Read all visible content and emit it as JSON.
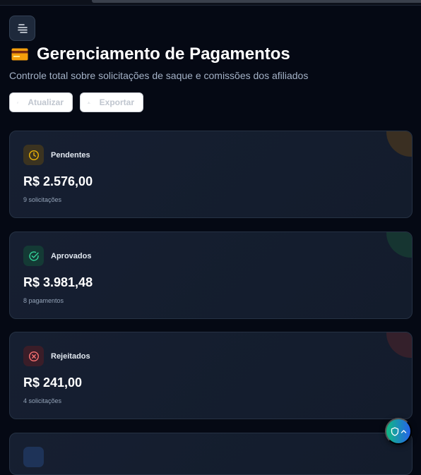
{
  "header": {
    "menu_icon": "menu-list-icon",
    "title_icon": "credit-card-icon",
    "title": "Gerenciamento de Pagamentos",
    "subtitle": "Controle total sobre solicitações de saque e comissões dos afiliados"
  },
  "toolbar": {
    "refresh_label": "Atualizar",
    "refresh_icon": "refresh-icon",
    "export_label": "Exportar",
    "export_icon": "download-icon"
  },
  "stats": [
    {
      "label": "Pendentes",
      "amount": "R$ 2.576,00",
      "detail": "9 solicitações",
      "icon": "clock-icon",
      "color": "#eab308"
    },
    {
      "label": "Aprovados",
      "amount": "R$ 3.981,48",
      "detail": "8 pagamentos",
      "icon": "check-circle-icon",
      "color": "#34d399"
    },
    {
      "label": "Rejeitados",
      "amount": "R$ 241,00",
      "detail": "4 solicitações",
      "icon": "x-circle-icon",
      "color": "#f87171"
    }
  ],
  "fab": {
    "icon": "shield-icon",
    "secondary_icon": "chevron-up-icon",
    "colors": [
      "#10b981",
      "#2563eb"
    ]
  }
}
